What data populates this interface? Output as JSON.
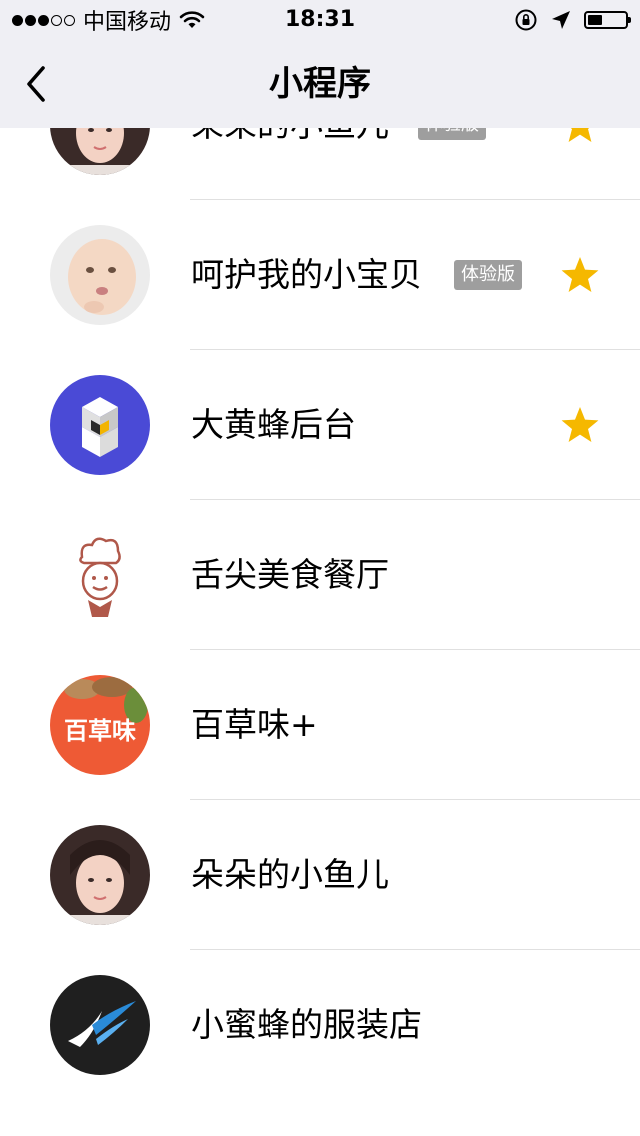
{
  "status_bar": {
    "carrier": "中国移动",
    "time": "18:31",
    "battery_level": 0.45
  },
  "nav": {
    "title": "小程序"
  },
  "items": [
    {
      "name": "朵朵的小鱼儿",
      "badge": "体验版",
      "starred": true
    },
    {
      "name": "呵护我的小宝贝",
      "badge": "体验版",
      "starred": true
    },
    {
      "name": "大黄蜂后台",
      "starred": true
    },
    {
      "name": "舌尖美食餐厅",
      "starred": false
    },
    {
      "name": "百草味+",
      "starred": false,
      "avatar_text": "百草味"
    },
    {
      "name": "朵朵的小鱼儿",
      "starred": false
    },
    {
      "name": "小蜜蜂的服装店",
      "starred": false
    }
  ],
  "colors": {
    "star": "#f5b800",
    "bar_bg": "#efeff4",
    "badge_bg": "#9e9e9e"
  }
}
